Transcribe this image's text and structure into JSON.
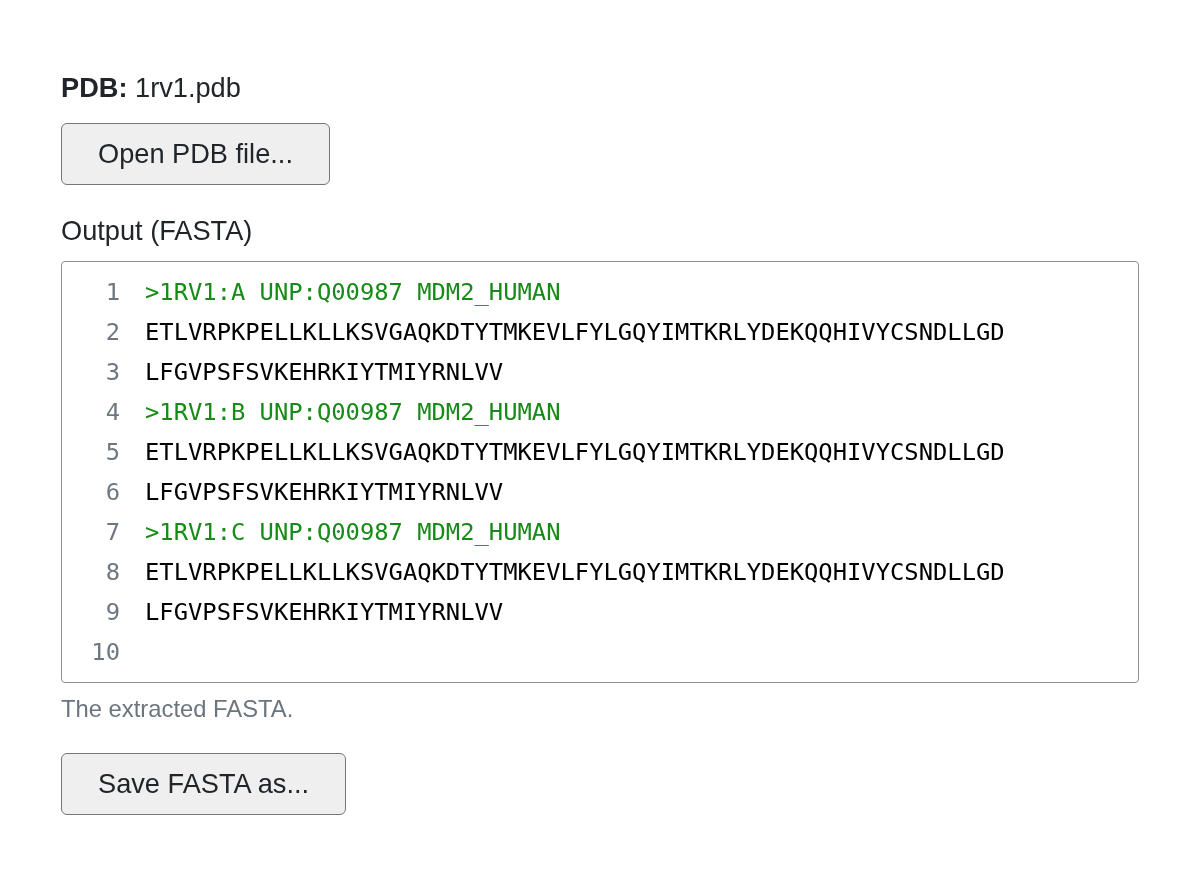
{
  "file_line": "**PDB:** 1rv1.pdb",
  "open_button": {
    "label": "Open PDB file..."
  },
  "output": {
    "label": "Output (FASTA)",
    "lines": [
      {
        "number": "1",
        "kind": "header",
        "text": ">1RV1:A UNP:Q00987 MDM2_HUMAN"
      },
      {
        "number": "2",
        "kind": "sequence",
        "text": "ETLVRPKPELLKLLKSVGAQKDTYTMKEVLFYLGQYIMTKRLYDEKQQHIVYCSNDLLGD"
      },
      {
        "number": "3",
        "kind": "sequence",
        "text": "LFGVPSFSVKEHRKIYTMIYRNLVV"
      },
      {
        "number": "4",
        "kind": "header",
        "text": ">1RV1:B UNP:Q00987 MDM2_HUMAN"
      },
      {
        "number": "5",
        "kind": "sequence",
        "text": "ETLVRPKPELLKLLKSVGAQKDTYTMKEVLFYLGQYIMTKRLYDEKQQHIVYCSNDLLGD"
      },
      {
        "number": "6",
        "kind": "sequence",
        "text": "LFGVPSFSVKEHRKIYTMIYRNLVV"
      },
      {
        "number": "7",
        "kind": "header",
        "text": ">1RV1:C UNP:Q00987 MDM2_HUMAN"
      },
      {
        "number": "8",
        "kind": "sequence",
        "text": "ETLVRPKPELLKLLKSVGAQKDTYTMKEVLFYLGQYIMTKRLYDEKQQHIVYCSNDLLGD"
      },
      {
        "number": "9",
        "kind": "sequence",
        "text": "LFGVPSFSVKEHRKIYTMIYRNLVV"
      },
      {
        "number": "10",
        "kind": "blank"
      }
    ],
    "help": "The extracted FASTA."
  },
  "save_button": {
    "label": "Save FASTA as..."
  }
}
